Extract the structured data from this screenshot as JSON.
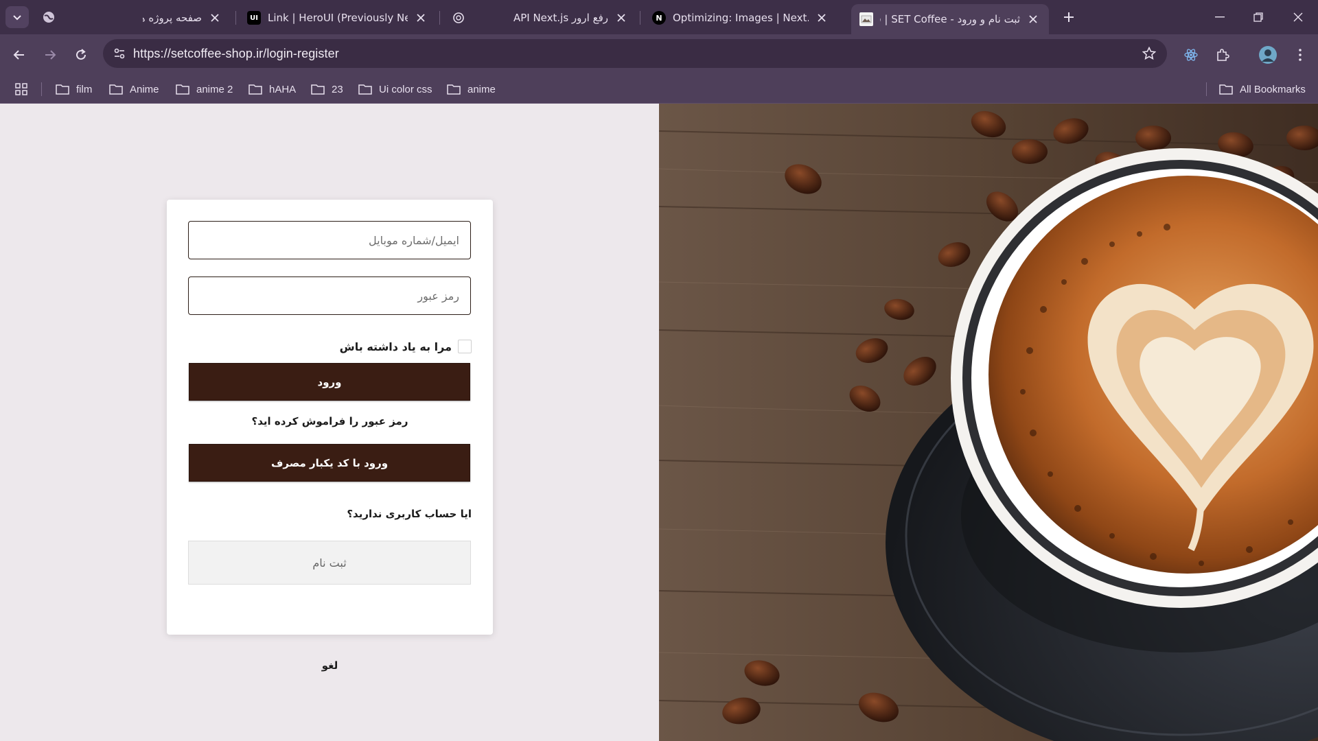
{
  "browser": {
    "tabs": [
      {
        "title": "صفحه پروژه ها",
        "active": false
      },
      {
        "title": "Link | HeroUI (Previously NextUI)",
        "favicon_text": "UI",
        "active": false
      },
      {
        "title": "رفع ارور API Next.js",
        "active": false
      },
      {
        "title": "Optimizing: Images | Next.js",
        "favicon_text": "N",
        "active": false
      },
      {
        "title": "ثبت نام و ورود - SET Coffee | فرو",
        "active": true
      }
    ],
    "url": "https://setcoffee-shop.ir/login-register",
    "bookmarks": [
      "film",
      "Anime",
      "anime 2",
      "hAHA",
      "23",
      "Ui color css",
      "anime"
    ],
    "all_bookmarks_label": "All Bookmarks",
    "icons": {
      "tab_search": "chevron-down-icon",
      "back": "arrow-left-icon",
      "forward": "arrow-right-icon",
      "reload": "reload-icon",
      "bookmark_star": "star-icon",
      "extensions": "puzzle-icon",
      "menu": "kebab-menu-icon"
    }
  },
  "login": {
    "email_placeholder": "ایمیل/شماره موبایل",
    "password_placeholder": "رمز عبور",
    "remember_me": "مرا به یاد داشته باش",
    "login_button": "ورود",
    "forgot_password": "رمز عبور را فراموش کرده اید؟",
    "otp_button": "ورود با کد یکبار مصرف",
    "no_account": "ایا حساب کاربری ندارید؟",
    "register_button": "ثبت نام",
    "cancel": "لغو"
  },
  "colors": {
    "brand_dark": "#3a1d13",
    "browser_frame": "#4e3f5a",
    "page_background": "#ede8ec"
  }
}
